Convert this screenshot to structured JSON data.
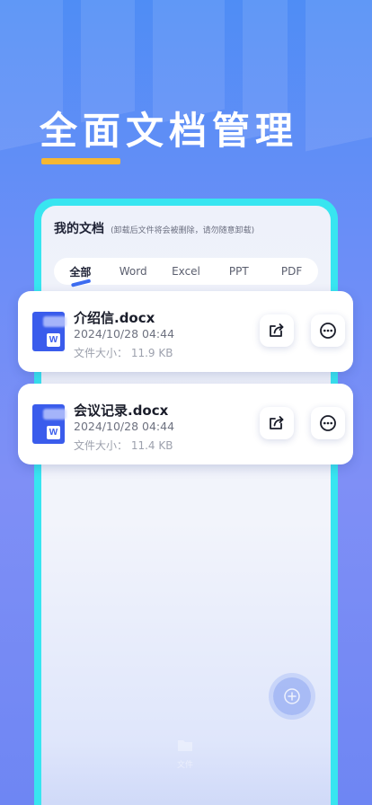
{
  "hero": {
    "title": "全面文档管理"
  },
  "panel": {
    "title": "我的文档",
    "note": "(卸载后文件将会被删除，请勿随意卸载)"
  },
  "tabs": [
    {
      "label": "全部",
      "active": true
    },
    {
      "label": "Word",
      "active": false
    },
    {
      "label": "Excel",
      "active": false
    },
    {
      "label": "PPT",
      "active": false
    },
    {
      "label": "PDF",
      "active": false
    }
  ],
  "files": [
    {
      "icon": "word-doc-icon",
      "icon_letter": "W",
      "name": "介绍信.docx",
      "date": "2024/10/28 04:44",
      "size": "文件大小：  11.9 KB"
    },
    {
      "icon": "word-doc-icon",
      "icon_letter": "W",
      "name": "会议记录.docx",
      "date": "2024/10/28 04:44",
      "size": "文件大小：  11.4 KB"
    }
  ],
  "bottom_nav": {
    "label": "文件"
  },
  "colors": {
    "accent": "#3a5cec",
    "frame": "#38e5f0",
    "underline": "#f5b733"
  }
}
